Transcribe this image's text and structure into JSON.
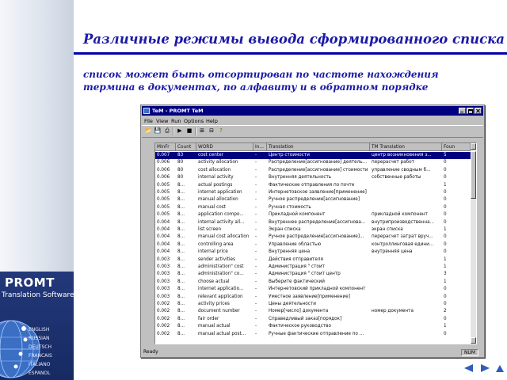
{
  "slide": {
    "title": "Различные режимы вывода сформированного списка",
    "subtitle_lines": [
      "список может быть отсортирован по частоте нахождения",
      "термина в документах, по алфавиту и в обратном порядке"
    ]
  },
  "brand": {
    "name": "PROMT",
    "tagline": "Translation Software",
    "languages": [
      "ENGLISH",
      "RUSSIAN",
      "DEUTSCH",
      "FRANCAIS",
      "ITALIANO",
      "ESPANOL"
    ]
  },
  "window": {
    "title": "TeM - PROMT TeM",
    "menu": [
      "File",
      "View",
      "Run",
      "Options",
      "Help"
    ],
    "toolbar_icons": [
      "open-icon",
      "save-icon",
      "print-icon",
      "run-icon",
      "stop-icon",
      "export-icon",
      "import-icon",
      "help-icon"
    ],
    "columns": [
      "MinFr",
      "Count",
      "WORD",
      "In...",
      "Translation",
      "TM Translation",
      "Foun"
    ],
    "rows": [
      [
        "0.007",
        "83",
        "cost center",
        "-",
        "Центр стоимости",
        "центр возникновения з...",
        "5"
      ],
      [
        "0.006",
        "80",
        "activity allocation",
        "-",
        "Распределение[ассигнование] деятель...",
        "перерасчет работ",
        "0"
      ],
      [
        "0.006",
        "80",
        "cost allocation",
        "-",
        "Распределение[ассигнование] стоимости",
        "управление сводным б...",
        "0"
      ],
      [
        "0.006",
        "80",
        "internal activity",
        "-",
        "Внутренняя деятельность",
        "собственные работы",
        "0"
      ],
      [
        "0.005",
        "8...",
        "actual postings",
        "-",
        "Фактические отправления по почте",
        "",
        "1"
      ],
      [
        "0.005",
        "8...",
        "internet application",
        "-",
        "Интернетовское заявление[применение]",
        "",
        "0"
      ],
      [
        "0.005",
        "8...",
        "manual allocation",
        "-",
        "Ручное распределение[ассигнование]",
        "",
        "0"
      ],
      [
        "0.005",
        "8...",
        "manual cost",
        "-",
        "Ручная стоимость",
        "",
        "0"
      ],
      [
        "0.005",
        "8...",
        "application compo...",
        "-",
        "Прикладной компонент",
        "прикладной компонент",
        "0"
      ],
      [
        "0.004",
        "8...",
        "internal activity all...",
        "-",
        "Внутреннее распределение[ассигнова...",
        "внутрипроизводственна...",
        "0"
      ],
      [
        "0.004",
        "8...",
        "list screen",
        "-",
        "Экран списка",
        "экран списка",
        "1"
      ],
      [
        "0.004",
        "8...",
        "manual cost allocation",
        "-",
        "Ручное распределение[ассигнование]...",
        "перерасчет затрат вруч...",
        "0"
      ],
      [
        "0.004",
        "8...",
        "controlling area",
        "-",
        "Управление областью",
        "контроллинговая едини...",
        "0"
      ],
      [
        "0.004",
        "8...",
        "internal price",
        "-",
        "Внутренняя цена",
        "внутренняя цена",
        "0"
      ],
      [
        "0.003",
        "8...",
        "sender activities",
        "-",
        "Действия отправителя",
        "",
        "1"
      ],
      [
        "0.003",
        "8...",
        "administration\" cost",
        "-",
        "Администрация \" стоит",
        "",
        "1"
      ],
      [
        "0.003",
        "8...",
        "administration\" co...",
        "-",
        "Администрация \" стоит центр",
        "",
        "3"
      ],
      [
        "0.003",
        "8...",
        "choose actual",
        "-",
        "Выберите фактический",
        "",
        "1"
      ],
      [
        "0.003",
        "8...",
        "internet applicatio...",
        "-",
        "Интернетовский прикладной компонент",
        "",
        "0"
      ],
      [
        "0.003",
        "8...",
        "relevant application",
        "-",
        "Уместное заявление[применение]",
        "",
        "0"
      ],
      [
        "0.002",
        "8...",
        "activity prices",
        "-",
        "Цены деятельности",
        "",
        "0"
      ],
      [
        "0.002",
        "8...",
        "document number",
        "-",
        "Номер[число] документа",
        "номер документа",
        "2"
      ],
      [
        "0.002",
        "8...",
        "fair order",
        "-",
        "Справедливый заказ[порядок]",
        "",
        "0"
      ],
      [
        "0.002",
        "8...",
        "manual actual",
        "-",
        "Фактическое руководство",
        "",
        "1"
      ],
      [
        "0.002",
        "8...",
        "manual actual post...",
        "-",
        "Ручные фактические отправление по ...",
        "",
        "0"
      ]
    ],
    "status_left": "Ready",
    "status_right": "NUM"
  },
  "colors": {
    "title_text": "#1a1aa6",
    "underline": "#0000aa",
    "brand_panel": "#1c3170",
    "selection": "#000080",
    "nav_arrows": "#2f5cc0"
  }
}
